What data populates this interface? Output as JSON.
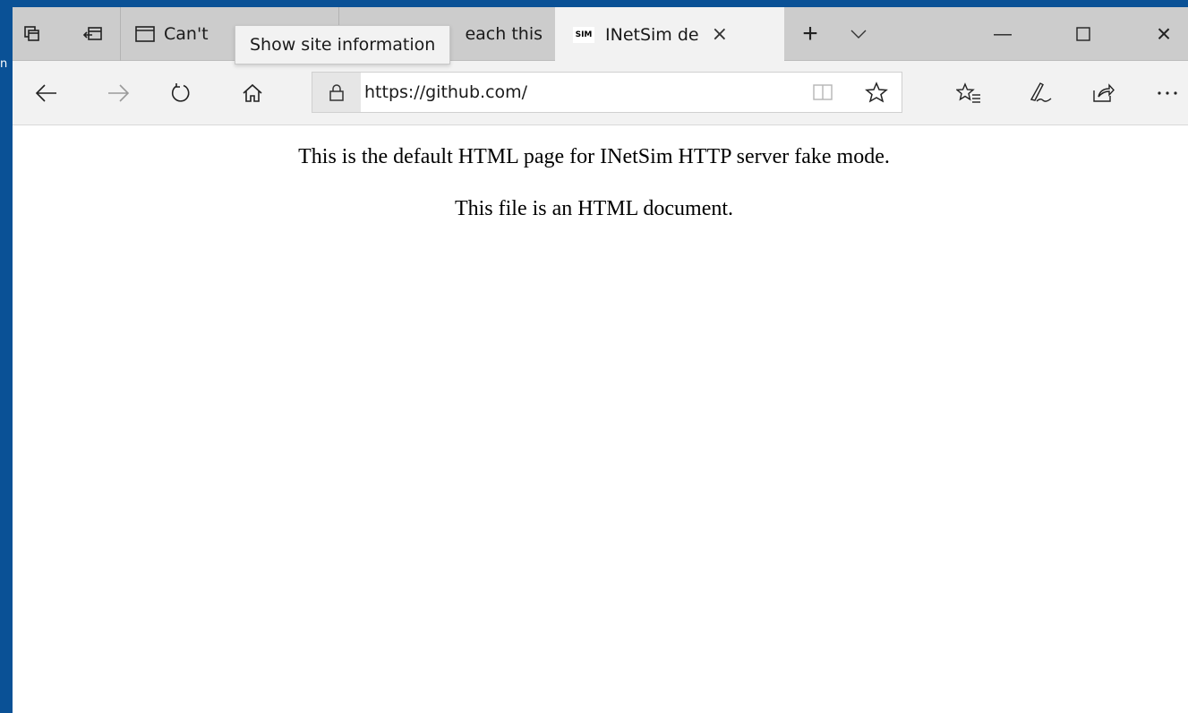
{
  "desktop": {
    "edge_letter": "n"
  },
  "tabs": {
    "set_aside_icon": "tabs-aside-icon",
    "restore_icon": "restore-tabs-icon",
    "items": [
      {
        "label": "Can't",
        "icon": "page-icon",
        "active": false
      },
      {
        "label": "each this",
        "icon": "none",
        "active": false
      },
      {
        "label": "INetSim de",
        "icon": "sim-favicon",
        "favicon_text": "SIM",
        "active": true
      }
    ],
    "close_glyph": "×",
    "new_tab_glyph": "+",
    "tab_list_glyph": "⌵"
  },
  "tooltip": {
    "text": "Show site information"
  },
  "window_controls": {
    "minimize": "—",
    "maximize": "☐",
    "close": "×"
  },
  "address_bar": {
    "url": "https://github.com/",
    "lock_icon": "lock-icon"
  },
  "page": {
    "line1": "This is the default HTML page for INetSim HTTP server fake mode.",
    "line2": "This file is an HTML document."
  },
  "colors": {
    "desktop": "#0a5196",
    "tabstrip": "#cccccc",
    "toolbar": "#f2f2f2"
  }
}
